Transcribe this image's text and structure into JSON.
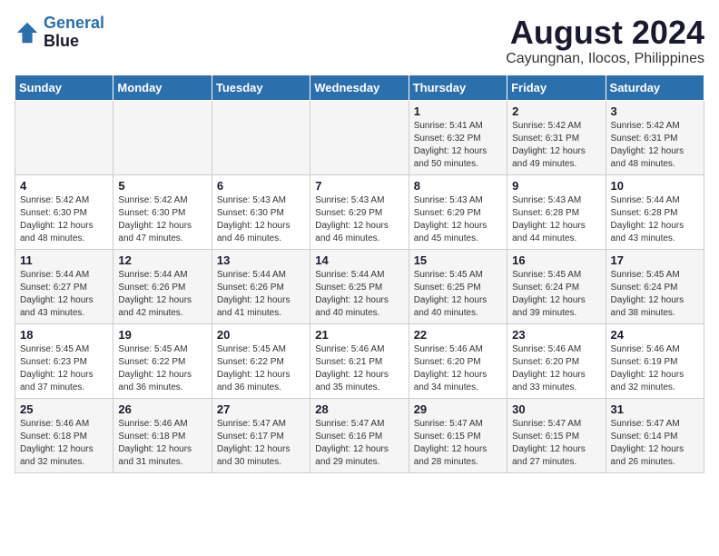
{
  "header": {
    "logo_line1": "General",
    "logo_line2": "Blue",
    "month_year": "August 2024",
    "location": "Cayungnan, Ilocos, Philippines"
  },
  "weekdays": [
    "Sunday",
    "Monday",
    "Tuesday",
    "Wednesday",
    "Thursday",
    "Friday",
    "Saturday"
  ],
  "weeks": [
    [
      {
        "day": "",
        "sunrise": "",
        "sunset": "",
        "daylight": ""
      },
      {
        "day": "",
        "sunrise": "",
        "sunset": "",
        "daylight": ""
      },
      {
        "day": "",
        "sunrise": "",
        "sunset": "",
        "daylight": ""
      },
      {
        "day": "",
        "sunrise": "",
        "sunset": "",
        "daylight": ""
      },
      {
        "day": "1",
        "sunrise": "Sunrise: 5:41 AM",
        "sunset": "Sunset: 6:32 PM",
        "daylight": "Daylight: 12 hours and 50 minutes."
      },
      {
        "day": "2",
        "sunrise": "Sunrise: 5:42 AM",
        "sunset": "Sunset: 6:31 PM",
        "daylight": "Daylight: 12 hours and 49 minutes."
      },
      {
        "day": "3",
        "sunrise": "Sunrise: 5:42 AM",
        "sunset": "Sunset: 6:31 PM",
        "daylight": "Daylight: 12 hours and 48 minutes."
      }
    ],
    [
      {
        "day": "4",
        "sunrise": "Sunrise: 5:42 AM",
        "sunset": "Sunset: 6:30 PM",
        "daylight": "Daylight: 12 hours and 48 minutes."
      },
      {
        "day": "5",
        "sunrise": "Sunrise: 5:42 AM",
        "sunset": "Sunset: 6:30 PM",
        "daylight": "Daylight: 12 hours and 47 minutes."
      },
      {
        "day": "6",
        "sunrise": "Sunrise: 5:43 AM",
        "sunset": "Sunset: 6:30 PM",
        "daylight": "Daylight: 12 hours and 46 minutes."
      },
      {
        "day": "7",
        "sunrise": "Sunrise: 5:43 AM",
        "sunset": "Sunset: 6:29 PM",
        "daylight": "Daylight: 12 hours and 46 minutes."
      },
      {
        "day": "8",
        "sunrise": "Sunrise: 5:43 AM",
        "sunset": "Sunset: 6:29 PM",
        "daylight": "Daylight: 12 hours and 45 minutes."
      },
      {
        "day": "9",
        "sunrise": "Sunrise: 5:43 AM",
        "sunset": "Sunset: 6:28 PM",
        "daylight": "Daylight: 12 hours and 44 minutes."
      },
      {
        "day": "10",
        "sunrise": "Sunrise: 5:44 AM",
        "sunset": "Sunset: 6:28 PM",
        "daylight": "Daylight: 12 hours and 43 minutes."
      }
    ],
    [
      {
        "day": "11",
        "sunrise": "Sunrise: 5:44 AM",
        "sunset": "Sunset: 6:27 PM",
        "daylight": "Daylight: 12 hours and 43 minutes."
      },
      {
        "day": "12",
        "sunrise": "Sunrise: 5:44 AM",
        "sunset": "Sunset: 6:26 PM",
        "daylight": "Daylight: 12 hours and 42 minutes."
      },
      {
        "day": "13",
        "sunrise": "Sunrise: 5:44 AM",
        "sunset": "Sunset: 6:26 PM",
        "daylight": "Daylight: 12 hours and 41 minutes."
      },
      {
        "day": "14",
        "sunrise": "Sunrise: 5:44 AM",
        "sunset": "Sunset: 6:25 PM",
        "daylight": "Daylight: 12 hours and 40 minutes."
      },
      {
        "day": "15",
        "sunrise": "Sunrise: 5:45 AM",
        "sunset": "Sunset: 6:25 PM",
        "daylight": "Daylight: 12 hours and 40 minutes."
      },
      {
        "day": "16",
        "sunrise": "Sunrise: 5:45 AM",
        "sunset": "Sunset: 6:24 PM",
        "daylight": "Daylight: 12 hours and 39 minutes."
      },
      {
        "day": "17",
        "sunrise": "Sunrise: 5:45 AM",
        "sunset": "Sunset: 6:24 PM",
        "daylight": "Daylight: 12 hours and 38 minutes."
      }
    ],
    [
      {
        "day": "18",
        "sunrise": "Sunrise: 5:45 AM",
        "sunset": "Sunset: 6:23 PM",
        "daylight": "Daylight: 12 hours and 37 minutes."
      },
      {
        "day": "19",
        "sunrise": "Sunrise: 5:45 AM",
        "sunset": "Sunset: 6:22 PM",
        "daylight": "Daylight: 12 hours and 36 minutes."
      },
      {
        "day": "20",
        "sunrise": "Sunrise: 5:45 AM",
        "sunset": "Sunset: 6:22 PM",
        "daylight": "Daylight: 12 hours and 36 minutes."
      },
      {
        "day": "21",
        "sunrise": "Sunrise: 5:46 AM",
        "sunset": "Sunset: 6:21 PM",
        "daylight": "Daylight: 12 hours and 35 minutes."
      },
      {
        "day": "22",
        "sunrise": "Sunrise: 5:46 AM",
        "sunset": "Sunset: 6:20 PM",
        "daylight": "Daylight: 12 hours and 34 minutes."
      },
      {
        "day": "23",
        "sunrise": "Sunrise: 5:46 AM",
        "sunset": "Sunset: 6:20 PM",
        "daylight": "Daylight: 12 hours and 33 minutes."
      },
      {
        "day": "24",
        "sunrise": "Sunrise: 5:46 AM",
        "sunset": "Sunset: 6:19 PM",
        "daylight": "Daylight: 12 hours and 32 minutes."
      }
    ],
    [
      {
        "day": "25",
        "sunrise": "Sunrise: 5:46 AM",
        "sunset": "Sunset: 6:18 PM",
        "daylight": "Daylight: 12 hours and 32 minutes."
      },
      {
        "day": "26",
        "sunrise": "Sunrise: 5:46 AM",
        "sunset": "Sunset: 6:18 PM",
        "daylight": "Daylight: 12 hours and 31 minutes."
      },
      {
        "day": "27",
        "sunrise": "Sunrise: 5:47 AM",
        "sunset": "Sunset: 6:17 PM",
        "daylight": "Daylight: 12 hours and 30 minutes."
      },
      {
        "day": "28",
        "sunrise": "Sunrise: 5:47 AM",
        "sunset": "Sunset: 6:16 PM",
        "daylight": "Daylight: 12 hours and 29 minutes."
      },
      {
        "day": "29",
        "sunrise": "Sunrise: 5:47 AM",
        "sunset": "Sunset: 6:15 PM",
        "daylight": "Daylight: 12 hours and 28 minutes."
      },
      {
        "day": "30",
        "sunrise": "Sunrise: 5:47 AM",
        "sunset": "Sunset: 6:15 PM",
        "daylight": "Daylight: 12 hours and 27 minutes."
      },
      {
        "day": "31",
        "sunrise": "Sunrise: 5:47 AM",
        "sunset": "Sunset: 6:14 PM",
        "daylight": "Daylight: 12 hours and 26 minutes."
      }
    ]
  ]
}
